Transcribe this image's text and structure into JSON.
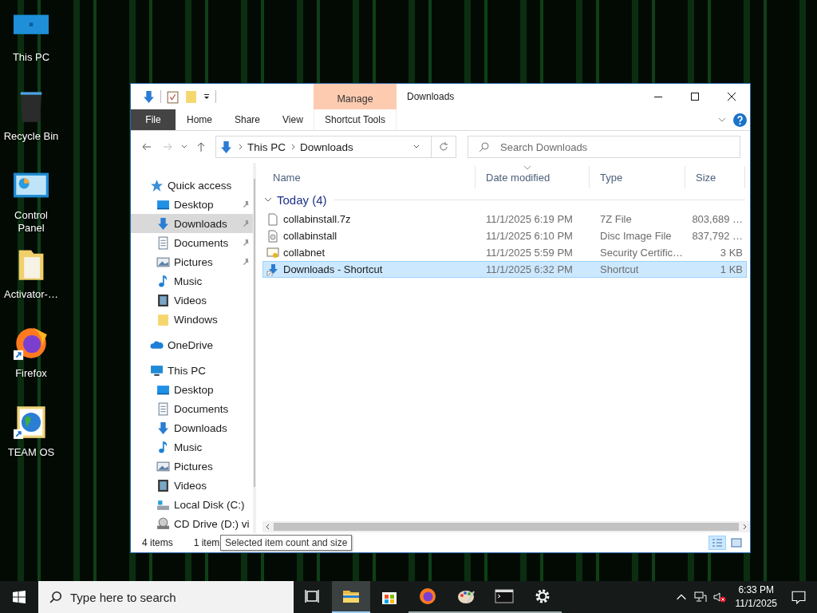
{
  "desktop_icons": [
    {
      "label": "This PC",
      "kind": "pc",
      "shortcut": false
    },
    {
      "label": "Recycle Bin",
      "kind": "bin",
      "shortcut": false
    },
    {
      "label": "Control Panel",
      "kind": "control",
      "shortcut": false
    },
    {
      "label": "Activator-…",
      "kind": "folder",
      "shortcut": false
    },
    {
      "label": "Firefox",
      "kind": "firefox",
      "shortcut": true
    },
    {
      "label": "TEAM OS",
      "kind": "globe",
      "shortcut": true
    }
  ],
  "window": {
    "title": "Downloads",
    "context_group": "Manage",
    "ribbon_tabs": [
      {
        "label": "File",
        "kind": "file",
        "selected": false
      },
      {
        "label": "Home",
        "kind": "plain",
        "selected": false
      },
      {
        "label": "Share",
        "kind": "plain",
        "selected": false
      },
      {
        "label": "View",
        "kind": "plain",
        "selected": false
      },
      {
        "label": "Shortcut Tools",
        "kind": "context",
        "selected": false
      }
    ],
    "address": {
      "path": [
        "This PC",
        "Downloads"
      ]
    },
    "search": {
      "placeholder": "Search Downloads"
    },
    "navigation": [
      {
        "label": "Quick access",
        "kind": "star",
        "selected": false,
        "children": [
          {
            "label": "Desktop",
            "kind": "desktop",
            "selected": false,
            "pinned": true
          },
          {
            "label": "Downloads",
            "kind": "download",
            "selected": true,
            "pinned": true
          },
          {
            "label": "Documents",
            "kind": "document",
            "selected": false,
            "pinned": true
          },
          {
            "label": "Pictures",
            "kind": "pictures",
            "selected": false,
            "pinned": true
          },
          {
            "label": "Music",
            "kind": "music",
            "selected": false,
            "pinned": false
          },
          {
            "label": "Videos",
            "kind": "videos",
            "selected": false,
            "pinned": false
          },
          {
            "label": "Windows",
            "kind": "folder",
            "selected": false,
            "pinned": false
          }
        ]
      },
      {
        "label": "OneDrive",
        "kind": "cloud",
        "selected": false
      },
      {
        "label": "This PC",
        "kind": "pc",
        "selected": false,
        "children": [
          {
            "label": "Desktop",
            "kind": "desktop",
            "selected": false
          },
          {
            "label": "Documents",
            "kind": "document",
            "selected": false
          },
          {
            "label": "Downloads",
            "kind": "download",
            "selected": false
          },
          {
            "label": "Music",
            "kind": "music",
            "selected": false
          },
          {
            "label": "Pictures",
            "kind": "pictures",
            "selected": false
          },
          {
            "label": "Videos",
            "kind": "videos",
            "selected": false
          },
          {
            "label": "Local Disk (C:)",
            "kind": "drive",
            "selected": false
          },
          {
            "label": "CD Drive (D:) vi",
            "kind": "cd",
            "selected": false
          }
        ]
      }
    ],
    "columns": [
      {
        "label": "Name",
        "sorted": false
      },
      {
        "label": "Date modified",
        "sorted": true
      },
      {
        "label": "Type",
        "sorted": false
      },
      {
        "label": "Size",
        "sorted": false
      }
    ],
    "group": {
      "label": "Today (4)",
      "expanded": true
    },
    "rows": [
      {
        "name": "collabinstall.7z",
        "kind": "archive",
        "date": "11/1/2025 6:19 PM",
        "type": "7Z File",
        "size": "803,689 …",
        "selected": false
      },
      {
        "name": "collabinstall",
        "kind": "disc",
        "date": "11/1/2025 6:10 PM",
        "type": "Disc Image File",
        "size": "837,792 …",
        "selected": false
      },
      {
        "name": "collabnet",
        "kind": "certificate",
        "date": "11/1/2025 5:59 PM",
        "type": "Security Certific…",
        "size": "3 KB",
        "selected": false
      },
      {
        "name": "Downloads - Shortcut",
        "kind": "shortcut",
        "date": "11/1/2025 6:32 PM",
        "type": "Shortcut",
        "size": "1 KB",
        "selected": true
      }
    ],
    "status_bar": {
      "item_count": "4 items",
      "selection": "1 item",
      "tooltip": "Selected item count and size",
      "views": [
        {
          "kind": "details",
          "selected": true
        },
        {
          "kind": "large_icons",
          "selected": false
        }
      ]
    }
  },
  "taskbar": {
    "search": {
      "placeholder": "Type here to search"
    },
    "apps": [
      {
        "kind": "task_view",
        "running": false,
        "selected": false
      },
      {
        "kind": "explorer",
        "running": true,
        "selected": true
      },
      {
        "kind": "store",
        "running": false,
        "selected": false
      },
      {
        "kind": "firefox",
        "running": true,
        "selected": false
      },
      {
        "kind": "paint",
        "running": true,
        "selected": false
      },
      {
        "kind": "terminal",
        "running": true,
        "selected": false
      },
      {
        "kind": "settings",
        "running": true,
        "selected": false
      }
    ],
    "time": "6:33 PM",
    "date": "11/1/2025",
    "volume_muted": true
  }
}
